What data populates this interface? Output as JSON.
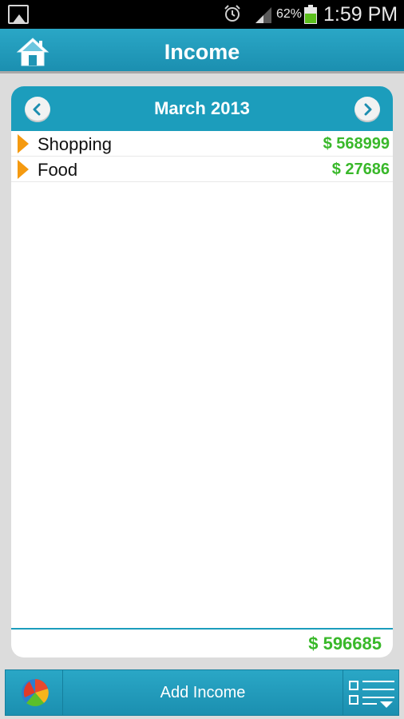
{
  "status_bar": {
    "battery_percent": "62%",
    "time": "1:59 PM",
    "icons": [
      "image-notification-icon",
      "alarm-icon",
      "signal-icon",
      "battery-icon"
    ],
    "battery_level": 0.62
  },
  "header": {
    "title": "Income",
    "home_icon": "home-icon"
  },
  "month_nav": {
    "label": "March 2013",
    "prev_icon": "chevron-left-icon",
    "next_icon": "chevron-right-icon"
  },
  "entries": [
    {
      "name": "Shopping",
      "amount": "$ 568999"
    },
    {
      "name": "Food",
      "amount": "$ 27686"
    }
  ],
  "total": "$ 596685",
  "bottom_bar": {
    "add_label": "Add Income",
    "chart_icon": "pie-chart-icon",
    "menu_icon": "list-menu-icon"
  },
  "colors": {
    "accent": "#1c9dbc",
    "amount_green": "#39b82a",
    "arrow_orange": "#f59a10"
  }
}
